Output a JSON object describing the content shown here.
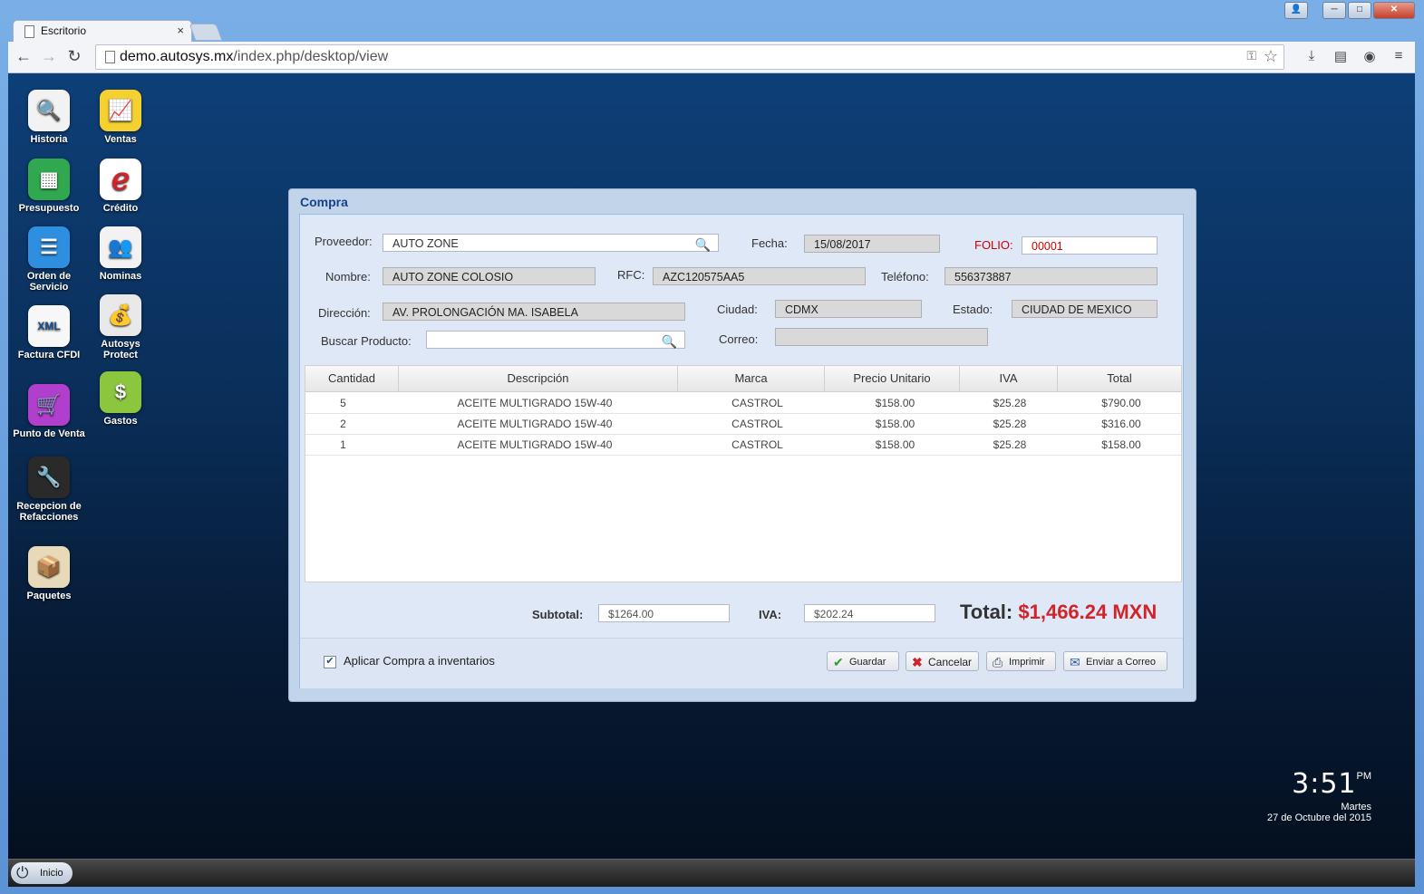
{
  "browser": {
    "tab_title": "Escritorio",
    "tab_close": "×",
    "url_host": "demo.autosys.mx",
    "url_path": "/index.php/desktop/view",
    "window_buttons": {
      "user": "👤",
      "minimize": "─",
      "maximize": "□",
      "close": "✕"
    }
  },
  "desktop_icons": [
    {
      "label": "Historia",
      "icon": "magnifier-icon",
      "glyph": "🔍",
      "bg": "#f2f2f2"
    },
    {
      "label": "Ventas",
      "icon": "line-chart-icon",
      "glyph": "📈",
      "bg": "#f5d031"
    },
    {
      "label": "Presupuesto",
      "icon": "spreadsheet-icon",
      "glyph": "▦",
      "bg": "#2fa84f"
    },
    {
      "label": "Crédito",
      "icon": "credit-swirl-icon",
      "glyph": "ℯ",
      "bg": "#ffffff"
    },
    {
      "label": "Orden de Servicio",
      "icon": "document-icon",
      "glyph": "☰",
      "bg": "#2e8fe0"
    },
    {
      "label": "Nominas",
      "icon": "payroll-people-icon",
      "glyph": "👥",
      "bg": "#f2f2f2"
    },
    {
      "label": "Factura CFDI",
      "icon": "xml-invoice-icon",
      "glyph": "XML",
      "bg": "#f7f7f7"
    },
    {
      "label": "Autosys Protect",
      "icon": "bandit-money-icon",
      "glyph": "💰",
      "bg": "#e9e9e9"
    },
    {
      "label": "Punto de Venta",
      "icon": "shopping-cart-icon",
      "glyph": "🛒",
      "bg": "#b13fce"
    },
    {
      "label": "Gastos",
      "icon": "coins-icon",
      "glyph": "$",
      "bg": "#8cc63f"
    },
    {
      "label": "Recepcion de Refacciones",
      "icon": "wrench-icon",
      "glyph": "🔧",
      "bg": "#2a2a2a"
    },
    {
      "label": "Paquetes",
      "icon": "package-box-icon",
      "glyph": "📦",
      "bg": "#e8d9b8"
    }
  ],
  "dialog": {
    "title": "Compra",
    "labels": {
      "proveedor": "Proveedor:",
      "fecha": "Fecha:",
      "folio": "FOLIO:",
      "nombre": "Nombre:",
      "rfc": "RFC:",
      "telefono": "Teléfono:",
      "direccion": "Dirección:",
      "ciudad": "Ciudad:",
      "estado": "Estado:",
      "buscar_producto": "Buscar Producto:",
      "correo": "Correo:"
    },
    "values": {
      "proveedor": "AUTO ZONE",
      "fecha": "15/08/2017",
      "folio": "00001",
      "nombre": "AUTO ZONE COLOSIO",
      "rfc": "AZC120575AA5",
      "telefono": "556373887",
      "direccion": "AV. PROLONGACIÓN MA. ISABELA",
      "ciudad": "CDMX",
      "estado": "CIUDAD DE MEXICO",
      "buscar_producto": "",
      "correo": ""
    },
    "grid": {
      "columns": [
        "Cantidad",
        "Descripción",
        "Marca",
        "Precio Unitario",
        "IVA",
        "Total"
      ],
      "rows": [
        [
          "5",
          "ACEITE MULTIGRADO 15W-40",
          "CASTROL",
          "$158.00",
          "$25.28",
          "$790.00"
        ],
        [
          "2",
          "ACEITE MULTIGRADO 15W-40",
          "CASTROL",
          "$158.00",
          "$25.28",
          "$316.00"
        ],
        [
          "1",
          "ACEITE MULTIGRADO 15W-40",
          "CASTROL",
          "$158.00",
          "$25.28",
          "$158.00"
        ]
      ]
    },
    "totals": {
      "subtotal_label": "Subtotal:",
      "subtotal": "$1264.00",
      "iva_label": "IVA:",
      "iva": "$202.24",
      "total_label": "Total:",
      "total": "$1,466.24 MXN"
    },
    "footer": {
      "checkbox_label": "Aplicar Compra a inventarios",
      "checkbox_checked": true,
      "buttons": {
        "guardar": "Guardar",
        "cancelar": "Cancelar",
        "imprimir": "Imprimir",
        "enviar": "Enviar a Correo"
      }
    }
  },
  "clock": {
    "time": "3:51",
    "ampm": "PM",
    "day": "Martes",
    "date": "27 de Octubre del 2015"
  },
  "taskbar": {
    "start_label": "Inicio"
  },
  "colors": {
    "accent_title": "#15428b",
    "total_amount": "#d2232a",
    "folio": "#cc0000"
  }
}
